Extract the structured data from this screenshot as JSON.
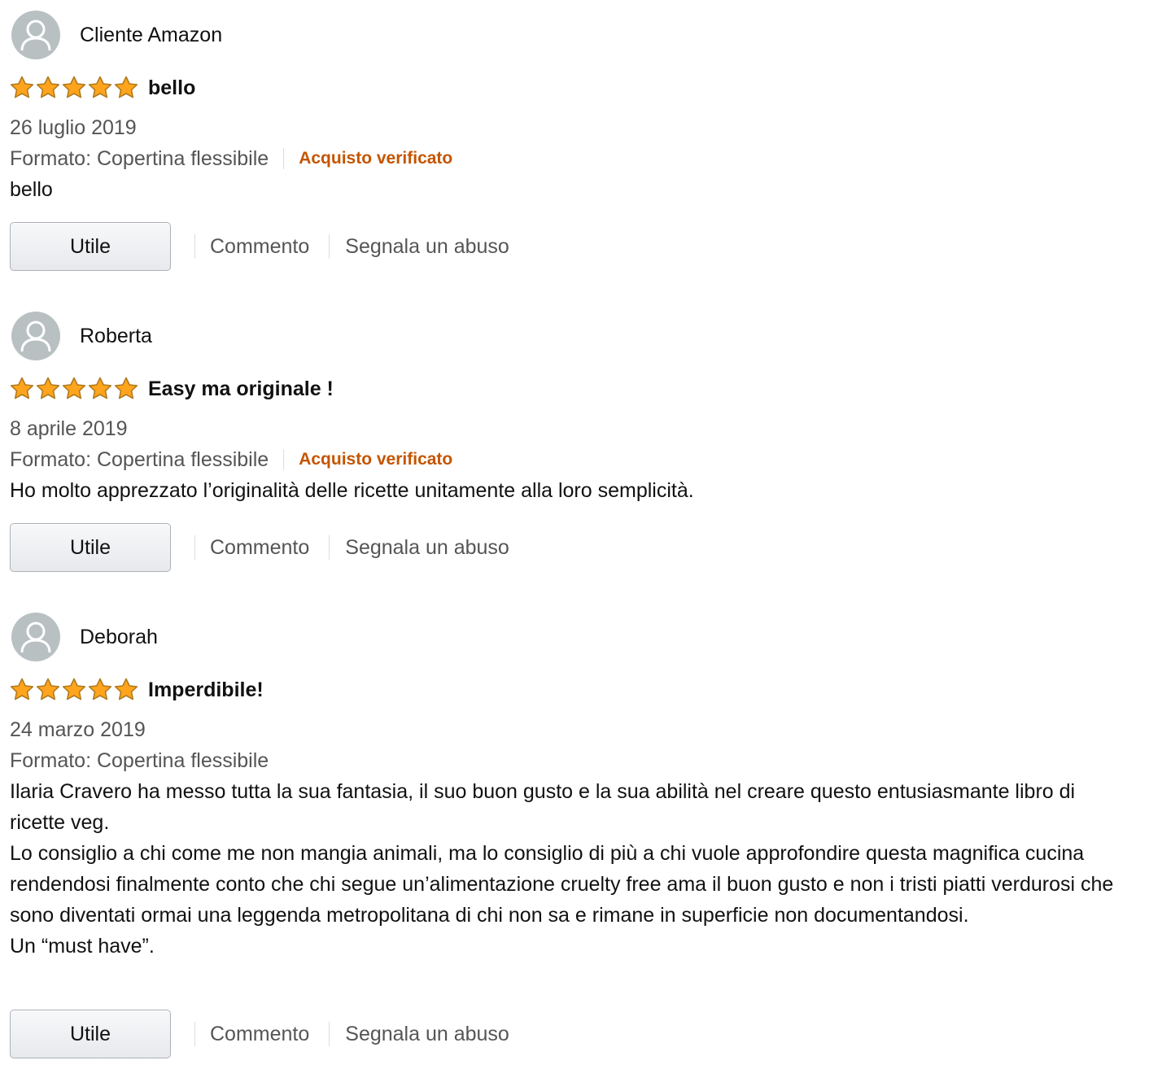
{
  "reviews": [
    {
      "author": "Cliente Amazon",
      "rating": 5,
      "max_rating": 5,
      "title": "bello",
      "date": "26 luglio 2019",
      "format": "Formato: Copertina flessibile",
      "verified": "Acquisto verificato",
      "body": [
        "bello"
      ],
      "helpful_label": "Utile",
      "comment_label": "Commento",
      "report_label": "Segnala un abuso"
    },
    {
      "author": "Roberta",
      "rating": 5,
      "max_rating": 5,
      "title": "Easy ma originale !",
      "date": "8 aprile 2019",
      "format": "Formato: Copertina flessibile",
      "verified": "Acquisto verificato",
      "body": [
        "Ho molto apprezzato l’originalità delle ricette unitamente alla loro semplicità."
      ],
      "helpful_label": "Utile",
      "comment_label": "Commento",
      "report_label": "Segnala un abuso"
    },
    {
      "author": "Deborah",
      "rating": 5,
      "max_rating": 5,
      "title": "Imperdibile!",
      "date": "24 marzo 2019",
      "format": "Formato: Copertina flessibile",
      "body": [
        "Ilaria Cravero ha messo tutta la sua fantasia, il suo buon gusto e la sua abilità nel creare questo entusiasmante libro di ricette veg.",
        "Lo consiglio a chi come me non mangia animali, ma lo consiglio di più a chi vuole approfondire questa magnifica cucina rendendosi finalmente conto che chi segue un’alimentazione cruelty free ama il buon gusto e non i tristi piatti verdurosi che sono diventati ormai una leggenda metropolitana di chi non sa e rimane in superficie non documentandosi.",
        "Un “must have”."
      ],
      "helpful_label": "Utile",
      "comment_label": "Commento",
      "report_label": "Segnala un abuso"
    }
  ],
  "colors": {
    "star": "#ffa41c",
    "verified": "#c45500",
    "muted_text": "#555555",
    "avatar_bg": "#b9c0c2"
  },
  "icons": {
    "avatar": "user-silhouette-icon",
    "star": "star-filled-icon"
  }
}
